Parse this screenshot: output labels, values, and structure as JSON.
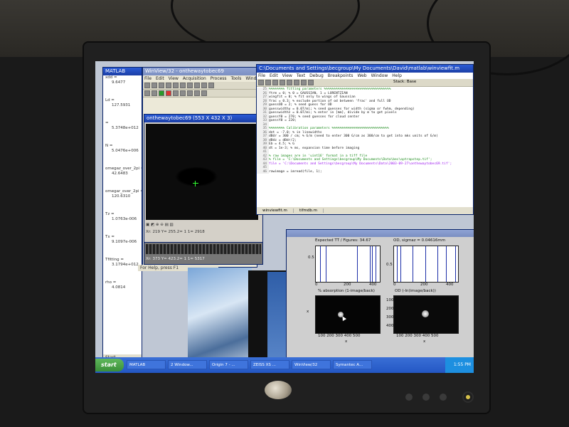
{
  "matlab": {
    "title": "MATLAB",
    "variables": [
      {
        "name": "xdd =",
        "value": "9.6477"
      },
      {
        "name": "Ld =",
        "value": "127.5931"
      },
      {
        "name": "=",
        "value": "5.3748e+012"
      },
      {
        "name": "N =",
        "value": "5.0476e+006"
      },
      {
        "name": "omegaz_over_2pi =",
        "value": "42.6483"
      },
      {
        "name": "omegar_over_2pi =",
        "value": "120.6310"
      },
      {
        "name": "Tz =",
        "value": "1.0763e-006"
      },
      {
        "name": "Tx =",
        "value": "9.1097e-006"
      },
      {
        "name": "Tfitting =",
        "value": "3.1794e+012"
      },
      {
        "name": "rho =",
        "value": "4.0814"
      }
    ],
    "status": "Start"
  },
  "winview": {
    "title": "WinView/32 - onthewaytobec69",
    "menu": [
      "File",
      "Edit",
      "View",
      "Acquisition",
      "Process",
      "Tools",
      "Window",
      "Help"
    ],
    "image_title": "onthewaytobec69 (553 X 432 X 3)",
    "status1": "Xr: 219 Y= 255.2=   1   1= 2918",
    "status2": "Xr: 373 Y= 423.2=   1   1= 5317",
    "help_status": "For Help, press F1"
  },
  "editor": {
    "title": "C:\\Documents and Settings\\becgroup\\My Documents\\David\\matlab\\winviewfit.m",
    "menu": [
      "File",
      "Edit",
      "View",
      "Text",
      "Debug",
      "Breakpoints",
      "Web",
      "Window",
      "Help"
    ],
    "stack_label": "Stack: Base",
    "lines": [
      {
        "num": "25",
        "text": "%%%%%%%% fitting parameters %%%%%%%%%%%%%%%%%%%%%%%%%%%%%%%%%%",
        "kind": "cm"
      },
      {
        "num": "26",
        "text": "ftrm = 0; % 0 = GAUSSIAN, 1 = LORENTZIAN",
        "kind": "code"
      },
      {
        "num": "27",
        "text": "wingfit = 0; % fit only to wings of Gaussian",
        "kind": "code"
      },
      {
        "num": "28",
        "text": "frac = 0.3; % exclude portion of od between 'frac' and full OD",
        "kind": "code"
      },
      {
        "num": "29",
        "text": "guessOD = 2; % seed guess for OD",
        "kind": "code"
      },
      {
        "num": "30",
        "text": "guesswidthy = 0.07/mi; % seed guesses for width (sigma or fwhm, depending)",
        "kind": "code"
      },
      {
        "num": "31",
        "text": "guesswidthz = 0.07/mi; % enter in [mm], divide by m to get pixels",
        "kind": "code"
      },
      {
        "num": "32",
        "text": "guessY0 = 270; % seed guesses for cloud center",
        "kind": "code"
      },
      {
        "num": "33",
        "text": "guessY0 = 220;",
        "kind": "code"
      },
      {
        "num": "34",
        "text": "",
        "kind": "code"
      },
      {
        "num": "35",
        "text": "%%%%%%%% Calibration parameters %%%%%%%%%%%%%%%%%%%%%%%%%%%%%",
        "kind": "cm"
      },
      {
        "num": "36",
        "text": "det = -7.0; % in linewidths",
        "kind": "code"
      },
      {
        "num": "37",
        "text": "dBdr = 300 / cm; % G/m (need to enter 300 G/cm as 300/cm to get into mks units of G/m)",
        "kind": "code"
      },
      {
        "num": "38",
        "text": "dBdz = dBdr/2;",
        "kind": "code"
      },
      {
        "num": "39",
        "text": "Eb = 4.5; % G",
        "kind": "code"
      },
      {
        "num": "40",
        "text": "dt = 1e-3; % ms, expansion time before imaging",
        "kind": "code"
      },
      {
        "num": "41",
        "text": "",
        "kind": "code"
      },
      {
        "num": "42",
        "text": "% raw images are in 'uint16' format in a tiff file",
        "kind": "cm"
      },
      {
        "num": "43",
        "text": "% file = 'C:\\Documents and Settings\\becgroup\\My Documents\\Data\\bec\\optrapstep.tif';",
        "kind": "cm"
      },
      {
        "num": "44",
        "text": "file = 'C:\\Documents and Settings\\becgroup\\My Documents\\Data\\2003-09-27\\onthewaytobec69.tif';",
        "kind": "str"
      },
      {
        "num": "45",
        "text": "",
        "kind": "code"
      },
      {
        "num": "46",
        "text": "rawimage = imread(file, 1);",
        "kind": "code"
      }
    ],
    "tabs": [
      "winviewfit.m",
      "tifmdb.m"
    ]
  },
  "figure": {
    "title1": "Figure No. 1",
    "left_top_label": "Expected TT / Figures: 34.67",
    "right_top_label": "OD, sigmaz = 0.04616mm",
    "top_tick_labels": [
      "0",
      "200",
      "400"
    ],
    "y_ticks_top": [
      "0.5",
      "1"
    ],
    "left_bottom_title": "% absorption (1-image/back)",
    "right_bottom_title": "OD (-ln(image/back))",
    "bottom_x_ticks": [
      "100",
      "200",
      "300",
      "400",
      "500"
    ],
    "bottom_y_ticks": [
      "100",
      "200",
      "300",
      "400"
    ],
    "x_axis_labels": [
      "x",
      "x"
    ]
  },
  "taskbar": {
    "start": "start",
    "tasks": [
      "MATLAB",
      "2 Window...",
      "Origin 7 - ...",
      "ZEISS XS ...",
      "WinView/32",
      "Symantec A..."
    ],
    "clock": "1:55 PM"
  }
}
